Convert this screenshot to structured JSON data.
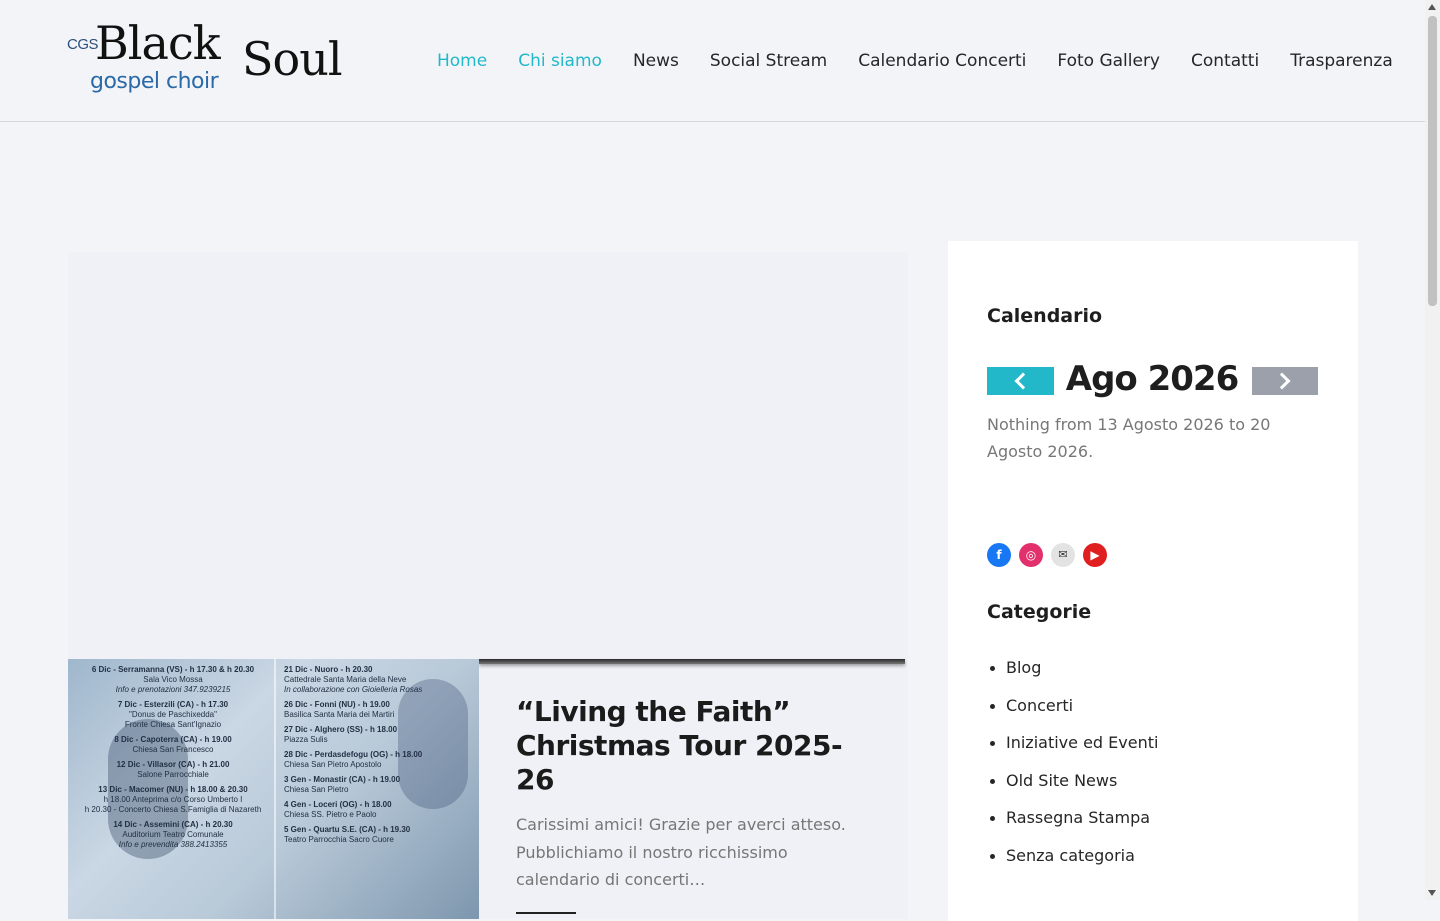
{
  "logo": {
    "cgs": "CGS",
    "black": "Black",
    "soul": "Soul",
    "tagline": "gospel choir"
  },
  "nav": {
    "items": [
      {
        "label": "Home",
        "active": true
      },
      {
        "label": "Chi siamo",
        "active": true
      },
      {
        "label": "News",
        "active": false
      },
      {
        "label": "Social Stream",
        "active": false
      },
      {
        "label": "Calendario Concerti",
        "active": false
      },
      {
        "label": "Foto Gallery",
        "active": false
      },
      {
        "label": "Contatti",
        "active": false
      },
      {
        "label": "Trasparenza",
        "active": false
      }
    ],
    "active_color": "#22b8c9"
  },
  "post": {
    "title": "“Living the Faith” Christmas Tour 2025-26",
    "excerpt": "Carissimi amici! Grazie per averci atteso. Pubblichiamo il nostro ricchissimo calendario di concerti…",
    "poster": {
      "left": [
        {
          "head": "6 Dic - Serramanna (VS) - h 17.30 & h 20.30",
          "place": "Sala Vico Mossa",
          "note": "Info e prenotazioni 347.9239215"
        },
        {
          "head": "7 Dic - Esterzili (CA) - h 17.30",
          "place": "\"Donus de Paschixedda\"",
          "note": "Fronte Chiesa Sant'Ignazio"
        },
        {
          "head": "8 Dic - Capoterra (CA) - h 19.00",
          "place": "Chiesa San Francesco",
          "note": ""
        },
        {
          "head": "12 Dic - Villasor (CA) - h 21.00",
          "place": "Salone Parrocchiale",
          "note": ""
        },
        {
          "head": "13 Dic - Macomer (NU) - h 18.00 & 20.30",
          "place": "h 18.00 Anteprima c/o Corso Umberto I",
          "note": "h 20.30 - Concerto Chiesa S.Famiglia di Nazareth"
        },
        {
          "head": "14 Dic - Assemini (CA) - h 20.30",
          "place": "Auditorium Teatro Comunale",
          "note": "Info e prevendita 388.2413355"
        }
      ],
      "right": [
        {
          "head": "21 Dic - Nuoro - h 20.30",
          "place": "Cattedrale Santa Maria della Neve",
          "note": "In collaborazione con Gioielleria Rosas"
        },
        {
          "head": "26 Dic - Fonni (NU) - h 19.00",
          "place": "Basilica Santa Maria dei Martiri",
          "note": ""
        },
        {
          "head": "27 Dic - Alghero (SS) - h 18.00",
          "place": "Piazza Sulis",
          "note": ""
        },
        {
          "head": "28 Dic - Perdasdefogu (OG) - h 18.00",
          "place": "Chiesa San Pietro Apostolo",
          "note": ""
        },
        {
          "head": "3 Gen - Monastir (CA) - h 19.00",
          "place": "Chiesa San Pietro",
          "note": ""
        },
        {
          "head": "4 Gen - Loceri (OG) - h 18.00",
          "place": "Chiesa SS. Pietro e Paolo",
          "note": ""
        },
        {
          "head": "5 Gen - Quartu S.E. (CA) - h 19.30",
          "place": "Teatro Parrocchia Sacro Cuore",
          "note": ""
        }
      ]
    }
  },
  "sidebar": {
    "calendar_title": "Calendario",
    "month": "Ago 2026",
    "empty_text": "Nothing from 13 Agosto 2026 to 20 Agosto 2026.",
    "prev_color": "#22b8c9",
    "next_color": "#9ba0ab",
    "social": [
      {
        "icon": "facebook-icon",
        "glyph": "f",
        "color": "#1877f2"
      },
      {
        "icon": "instagram-icon",
        "glyph": "◎",
        "color": "#e1306c"
      },
      {
        "icon": "mail-icon",
        "glyph": "✉",
        "color": "#e3e3e3"
      },
      {
        "icon": "youtube-icon",
        "glyph": "▶",
        "color": "#e02020"
      }
    ],
    "categories_title": "Categorie",
    "categories": [
      "Blog",
      "Concerti",
      "Iniziative ed Eventi",
      "Old Site News",
      "Rassegna Stampa",
      "Senza categoria"
    ]
  }
}
